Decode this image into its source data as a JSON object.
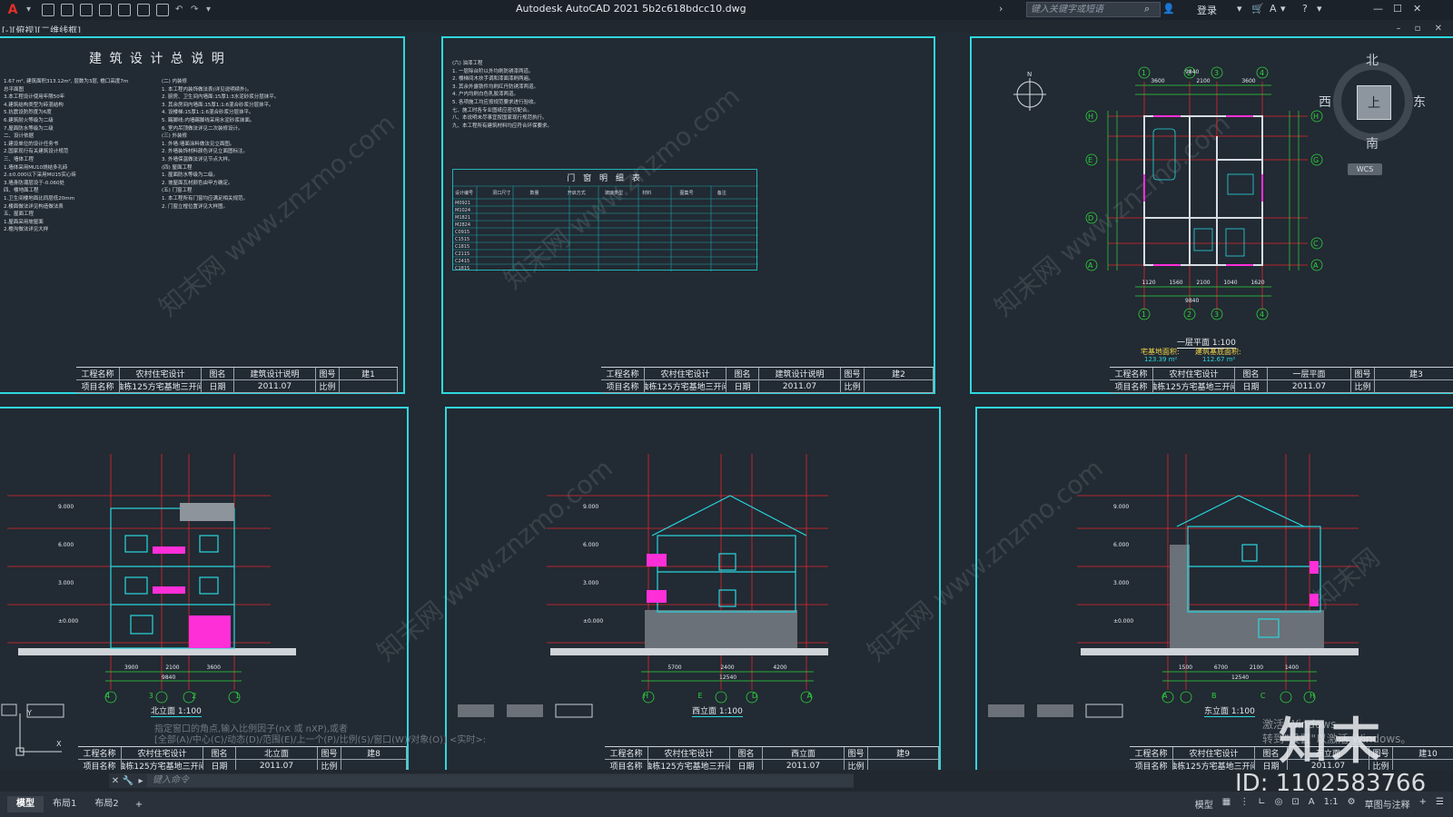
{
  "titlebar": {
    "title": "Autodesk AutoCAD 2021    5b2c618bdcc10.dwg",
    "search_placeholder": "键入关键字或短语",
    "login": "登录"
  },
  "viewport_label": "[-][俯视][二维线框]",
  "viewcube": {
    "top": "上",
    "north": "北",
    "south": "南",
    "east": "东",
    "west": "西",
    "wcs": "WCS"
  },
  "common": {
    "project_name_label": "工程名称",
    "project_name": "农村住宅设计",
    "item_label": "项目名称",
    "item_name": "(独栋125方宅基地三开间)",
    "drawing_label": "图名",
    "date_label": "日期",
    "date": "2011.07",
    "scale_label": "比例",
    "number_label": "图号"
  },
  "sheets": [
    {
      "title": "建 筑 设 计 总 说 明",
      "drawing_name": "建筑设计说明",
      "number": "建1"
    },
    {
      "title": "门 窗 明 细 表",
      "drawing_name": "建筑设计说明",
      "number": "建2"
    },
    {
      "title": "一层平面 1:100",
      "drawing_name": "一层平面",
      "number": "建3",
      "area_label_1": "宅基地面积:",
      "area_value_1": "123.39 m²",
      "area_label_2": "建筑基底面积:",
      "area_value_2": "112.67 m²"
    },
    {
      "title": "北立面 1:100",
      "drawing_name": "北立面",
      "number": "建8"
    },
    {
      "title": "西立面 1:100",
      "drawing_name": "西立面",
      "number": "建9"
    },
    {
      "title": "东立面 1:100",
      "drawing_name": "东立面",
      "number": "建10"
    }
  ],
  "notes_left": "(二) 内装修\n1. 本工程内装饰做法表(详见说明续外)。\n2. 厨房、卫生间内墙面:15厚1:3水泥砂浆分层抹平。\n3. 其余房间内墙面:15厚1:1:6混合砂浆分层抹平。\n4. 设楼梯:15厚1:1:6混合砂浆分层抹平。\n5. 踢脚线:内墙踢脚线采用水泥砂浆抹面。\n6. 室内吊顶做法详见二次装修设计。\n(三) 外装修\n1. 外墙:墙面涂料做法见立面图。\n2. 外墙装饰材料颜色详见立面图标注。\n3. 外墙保温做法详见节点大样。\n(四) 屋面工程\n1. 屋面防水等级为二级。\n2. 坡屋面瓦材颜色由甲方确定。\n(五) 门窗工程\n1. 本工程所有门窗均应满足相关规范。\n2. 门窗立樘位置详见大样图。",
  "notes_right": "(六) 油漆工程\n1. 一层除台阶以外均刷防锈漆两道。\n2. 楼梯间木扶手调和漆面漆刷两遍。\n3. 其余外露铁件均刷红丹防锈漆两道。\n4. 户内均刷白色乳胶漆两道。\n5. 各项施工均应按规范要求进行验收。\n七、施工时各专业图纸应密切配合。\n八、本说明未尽事宜按国家现行规范执行。\n九、本工程所有建筑材料均应符合环保要求。",
  "door_table": {
    "headers": [
      "设计编号",
      "洞口尺寸",
      "数量",
      "开启方式",
      "玻璃类型",
      "材料",
      "图集号",
      "备注"
    ],
    "rows": [
      "M0921",
      "M1024",
      "M1821",
      "M2824",
      "C0915",
      "C1515",
      "C1815",
      "C2115",
      "C2415",
      "C1815"
    ]
  },
  "plan_dims": {
    "top": [
      "3600",
      "2100",
      "3600"
    ],
    "top_total": "9840",
    "bottom": [
      "1120",
      "1560",
      "2100",
      "1040",
      "1620"
    ],
    "bottom_total": "9840"
  },
  "elevations": {
    "levels": [
      "12.085",
      "11.550",
      "9.000",
      "6.000",
      "3.000",
      "±0.000",
      "-0.450"
    ],
    "north_dims": [
      "3900",
      "2100",
      "3600"
    ],
    "north_total": "9840",
    "west_dims": [
      "5700",
      "2400",
      "4200"
    ],
    "west_total": "12540",
    "east_dims": [
      "1500",
      "6700",
      "2100",
      "1400"
    ],
    "east_total": "12540",
    "north_axes": [
      "4",
      "3",
      "2",
      "1"
    ],
    "west_axes": [
      "H",
      "E",
      "D",
      "A"
    ],
    "east_axes": [
      "A",
      "B",
      "C",
      "H"
    ]
  },
  "command": {
    "history_1": "指定窗口的角点,输入比例因子(nX 或 nXP),或者",
    "history_2": "[全部(A)/中心(C)/动态(D)/范围(E)/上一个(P)/比例(S)/窗口(W)/对象(O)] <实时>:",
    "placeholder": "键入命令"
  },
  "layout_tabs": [
    "模型",
    "布局1",
    "布局2"
  ],
  "status": {
    "model": "模型",
    "scale": "1:1",
    "annotation": "草图与注释"
  },
  "watermark": {
    "brand": "知末",
    "id": "ID: 1102583766",
    "activate_1": "激活 Windows",
    "activate_2": "转到\"设置\"以激活 Windows。"
  },
  "colors": {
    "sheet_border": "#2fd7df",
    "background": "#222a33",
    "axis_red": "#e3262b",
    "dim_green": "#2ed43d",
    "elevation_cyan": "#29d8e0",
    "accent_magenta": "#ff2fd8"
  }
}
